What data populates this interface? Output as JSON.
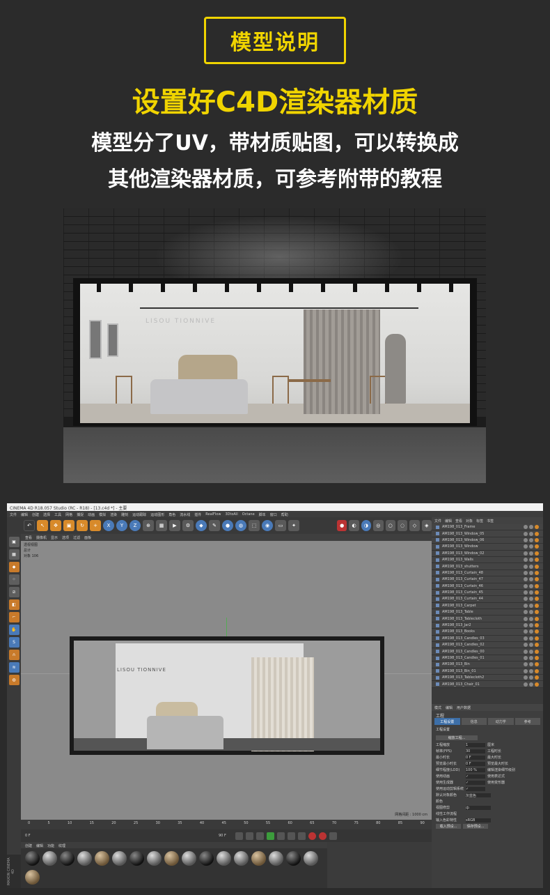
{
  "header": {
    "badge": "模型说明",
    "headline": "设置好C4D渲染器材质",
    "line1": "模型分了UV，带材质贴图，可以转换成",
    "line2": "其他渲染器材质，可参考附带的教程"
  },
  "render": {
    "wall_sign": "LISOU TIONNIVE"
  },
  "c4d": {
    "title": "CINEMA 4D R18.057 Studio (RC - R18) - [13.c4d *] - 主要",
    "menu": [
      "文件",
      "编辑",
      "创建",
      "选择",
      "工具",
      "网格",
      "捕捉",
      "动画",
      "模拟",
      "渲染",
      "雕刻",
      "运动跟踪",
      "运动图形",
      "角色",
      "流水线",
      "插件",
      "RealFlow",
      "3DtoAll",
      "Octane",
      "脚本",
      "窗口",
      "帮助"
    ],
    "tools": [
      "X",
      "Y",
      "Z"
    ],
    "viewport_menu": [
      "查看",
      "摄像机",
      "显示",
      "选项",
      "过滤",
      "面板"
    ],
    "viewport_label": "透视视图",
    "viewport_sub1": "总计",
    "viewport_sub2": "对象 106",
    "scene_text": "LISOU TIONNIVE",
    "grid_spacing": "网格间距 : 1000 cm",
    "timeline_ticks": [
      "0",
      "5",
      "10",
      "15",
      "20",
      "25",
      "30",
      "35",
      "40",
      "45",
      "50",
      "55",
      "60",
      "65",
      "70",
      "75",
      "80",
      "85",
      "90"
    ],
    "frame_start": "0 F",
    "frame_end": "90 F",
    "frame_current": "0 F",
    "material_menu": [
      "创建",
      "编辑",
      "功能",
      "纹理"
    ],
    "material_label": "AM198",
    "maxon": "MAXON CINEMA 4D",
    "object_manager_menu": [
      "文件",
      "编辑",
      "查看",
      "对象",
      "标签",
      "书签"
    ],
    "objects": [
      "AM198_013_Frame",
      "AM198_013_Window_05",
      "AM198_013_Window_06",
      "AM198_013_Window",
      "AM198_013_Window_02",
      "AM198_013_Walls",
      "AM198_013_shutters",
      "AM198_013_Curtain_48",
      "AM198_013_Curtain_47",
      "AM198_013_Curtain_46",
      "AM198_013_Curtain_45",
      "AM198_013_Curtain_44",
      "AM198_013_Carpet",
      "AM198_013_Table",
      "AM198_013_Tablecloth",
      "AM198_013_Jar2",
      "AM198_013_Books",
      "AM198_013_Candles_03",
      "AM198_013_Candles_02",
      "AM198_013_Candles_00",
      "AM198_013_Candles_01",
      "AM198_013_Bin",
      "AM198_013_Bin_01",
      "AM198_013_Tablecloth2",
      "AM198_013_Chair_01"
    ],
    "attr_menu": [
      "模式",
      "编辑",
      "用户数据"
    ],
    "attr_title": "工程",
    "attr_tabs": [
      "工程设置",
      "信息",
      "动力学",
      "参考"
    ],
    "attr_section": "工程设置",
    "attr_rows": [
      {
        "label": "工程缩放",
        "value": "1",
        "unit": "厘米"
      },
      {
        "label": "帧率(FPS)",
        "value": "30",
        "unit": "工程时长"
      },
      {
        "label": "最小时长",
        "value": "0 F",
        "unit": "最大时长"
      },
      {
        "label": "预览最小时长",
        "value": "0 F",
        "unit": "预览最大时长"
      },
      {
        "label": "细节程度(LOD)",
        "value": "100 %",
        "unit": "编辑渲染细节级别"
      },
      {
        "label": "使用动画",
        "value": "✓",
        "unit": "使用表达式"
      },
      {
        "label": "使用生成器",
        "value": "✓",
        "unit": "使用变形器"
      },
      {
        "label": "使用运动剪辑系统",
        "value": "✓",
        "unit": ""
      }
    ],
    "attr_scale_btn": "缩放工程...",
    "default_color_label": "默认对象颜色",
    "default_color_value": "灰蓝色",
    "color_label": "颜色",
    "view_clip_label": "视图修剪",
    "view_clip_value": "中",
    "linear_label": "线性工作流程",
    "input_color_label": "输入色彩特性",
    "input_color_value": "sRGB",
    "load_btn": "载入预设...",
    "save_btn": "保存预设...",
    "apply_btn": "应用"
  }
}
